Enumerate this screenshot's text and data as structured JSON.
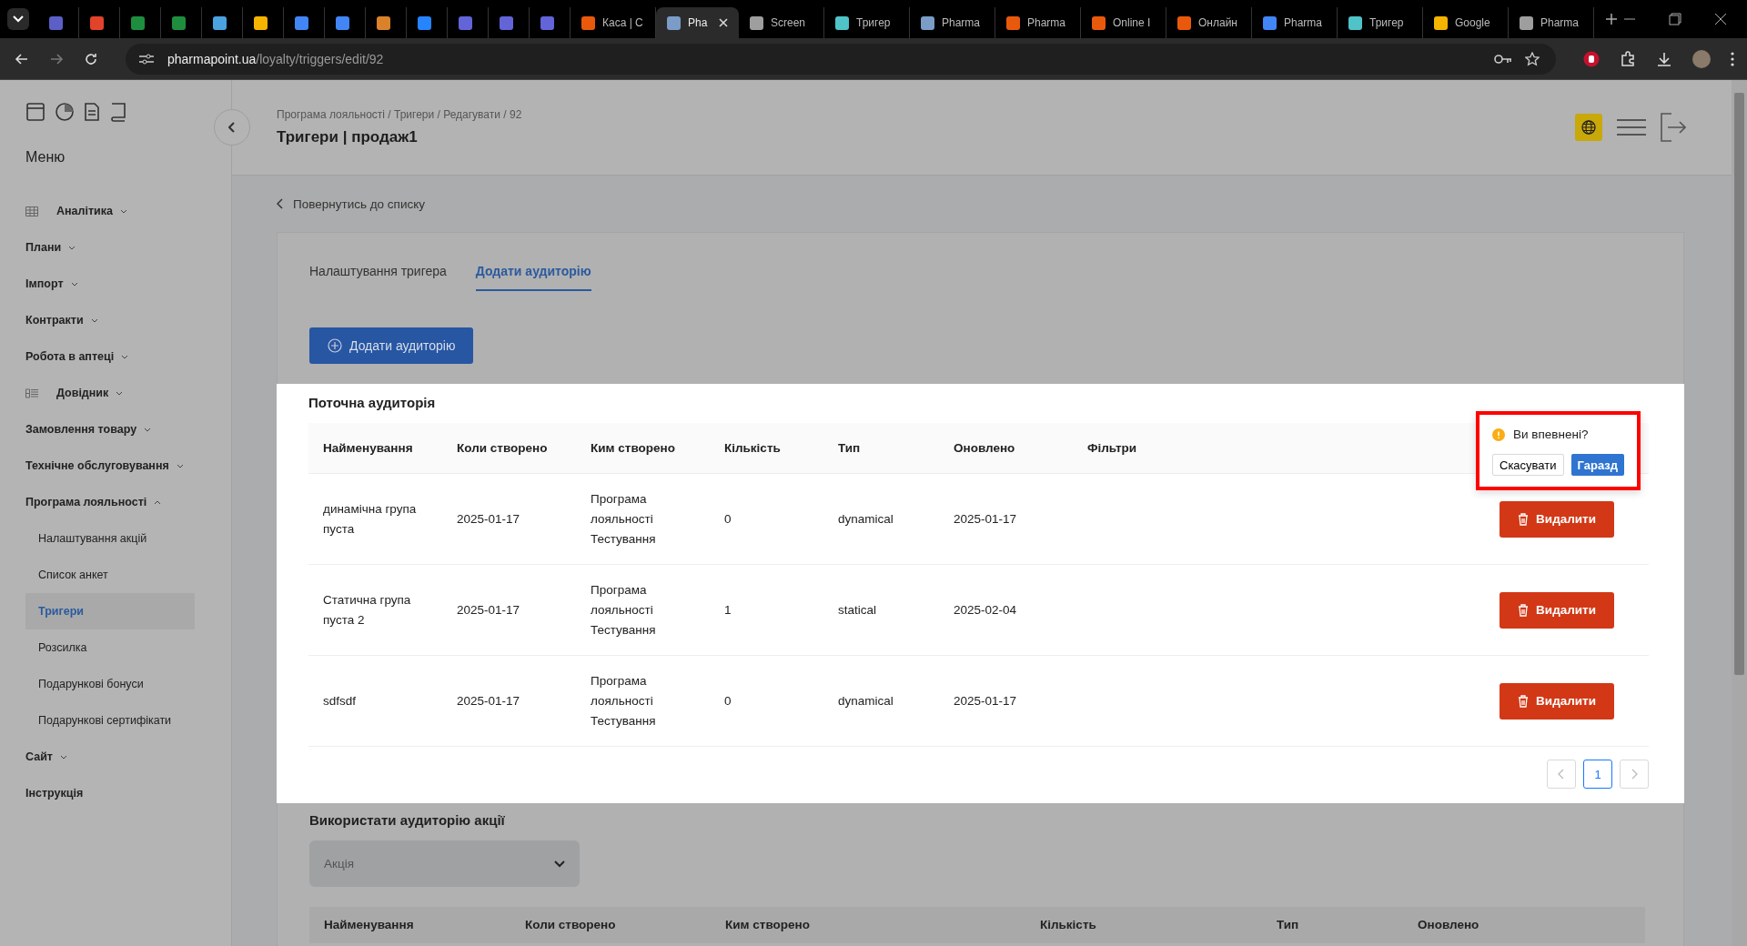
{
  "browser": {
    "tabs": [
      {
        "color": "#5b5fc7",
        "selected": false
      },
      {
        "color": "#e2432a",
        "selected": false
      },
      {
        "color": "#1e8e3e",
        "selected": false
      },
      {
        "color": "#1e8e3e",
        "selected": false
      },
      {
        "color": "#4aa3df",
        "selected": false
      },
      {
        "color": "#f4b400",
        "selected": false
      },
      {
        "color": "#4285f4",
        "selected": false
      },
      {
        "color": "#4285f4",
        "selected": false
      },
      {
        "color": "#d9822b",
        "selected": false
      },
      {
        "color": "#2684ff",
        "selected": false
      },
      {
        "color": "#6264d8",
        "selected": false
      },
      {
        "color": "#6264d8",
        "selected": false
      },
      {
        "color": "#6264d8",
        "selected": false
      },
      {
        "title": "Каса | С",
        "color": "#e8590c",
        "selected": false
      },
      {
        "title": "Pha",
        "color": "#7a9cc6",
        "selected": true
      },
      {
        "title": "Screen",
        "color": "#9e9e9e",
        "selected": false
      },
      {
        "title": "Тригер",
        "color": "#4fc3c7",
        "selected": false
      },
      {
        "title": "Pharma",
        "color": "#7a9cc6",
        "selected": false
      },
      {
        "title": "Pharma",
        "color": "#e8590c",
        "selected": false
      },
      {
        "title": "Online I",
        "color": "#e8590c",
        "selected": false
      },
      {
        "title": "Онлайн",
        "color": "#e8590c",
        "selected": false
      },
      {
        "title": "Pharma",
        "color": "#4285f4",
        "selected": false
      },
      {
        "title": "Тригер",
        "color": "#4fc3c7",
        "selected": false
      },
      {
        "title": "Google",
        "color": "#f4b400",
        "selected": false
      },
      {
        "title": "Pharma",
        "color": "#9e9e9e",
        "selected": false
      }
    ],
    "url_host": "pharmapoint.ua",
    "url_path": "/loyalty/triggers/edit/92"
  },
  "sidebar": {
    "title": "Меню",
    "items": [
      {
        "label": "Аналітика",
        "kind": "grid",
        "expanded": false
      },
      {
        "label": "Плани",
        "kind": "plain",
        "expanded": false
      },
      {
        "label": "Імпорт",
        "kind": "plain",
        "expanded": false
      },
      {
        "label": "Контракти",
        "kind": "plain",
        "expanded": false
      },
      {
        "label": "Робота в аптеці",
        "kind": "plain",
        "expanded": false
      },
      {
        "label": "Довідник",
        "kind": "list",
        "expanded": false
      },
      {
        "label": "Замовлення товару",
        "kind": "plain",
        "expanded": false
      },
      {
        "label": "Технічне обслуговування",
        "kind": "plain",
        "expanded": false
      },
      {
        "label": "Програма лояльності",
        "kind": "plain",
        "expanded": true,
        "children": [
          {
            "label": "Налаштування акцій",
            "selected": false
          },
          {
            "label": "Список анкет",
            "selected": false
          },
          {
            "label": "Тригери",
            "selected": true
          },
          {
            "label": "Розсилка",
            "selected": false
          },
          {
            "label": "Подарункові бонуси",
            "selected": false
          },
          {
            "label": "Подарункові сертифікати",
            "selected": false
          }
        ]
      },
      {
        "label": "Сайт",
        "kind": "plain",
        "expanded": false
      },
      {
        "label": "Інструкція",
        "kind": "plain"
      }
    ]
  },
  "header": {
    "breadcrumb": "Програма лояльності / Тригери / Редагувати / 92",
    "title": "Тригери | продаж1"
  },
  "back_link": "Повернутись до списку",
  "tabs": [
    {
      "label": "Налаштування тригера",
      "selected": false
    },
    {
      "label": "Додати аудиторію",
      "selected": true
    }
  ],
  "add_button": "Додати аудиторію",
  "current_audience": {
    "title": "Поточна аудиторія",
    "columns": [
      "Найменування",
      "Коли створено",
      "Ким створено",
      "Кількість",
      "Тип",
      "Оновлено",
      "Фільтри"
    ],
    "rows": [
      {
        "name": "динамічна група пуста",
        "created": "2025-01-17",
        "author": "Програма лояльності Тестування",
        "count": "0",
        "type": "dynamical",
        "updated": "2025-01-17",
        "action": "Видалити"
      },
      {
        "name": "Статична група пуста 2",
        "created": "2025-01-17",
        "author": "Програма лояльності Тестування",
        "count": "1",
        "type": "statical",
        "updated": "2025-02-04",
        "action": "Видалити"
      },
      {
        "name": "sdfsdf",
        "created": "2025-01-17",
        "author": "Програма лояльності Тестування",
        "count": "0",
        "type": "dynamical",
        "updated": "2025-01-17",
        "action": "Видалити"
      }
    ],
    "pages": [
      {
        "label": "1",
        "selected": true
      }
    ]
  },
  "confirm": {
    "question": "Ви впевнені?",
    "cancel": "Скасувати",
    "ok": "Гаразд"
  },
  "use_audience": {
    "title": "Використати аудиторію акції",
    "select_placeholder": "Акція",
    "columns": [
      "Найменування",
      "Коли створено",
      "Ким створено",
      "Кількість",
      "Тип",
      "Оновлено"
    ]
  }
}
